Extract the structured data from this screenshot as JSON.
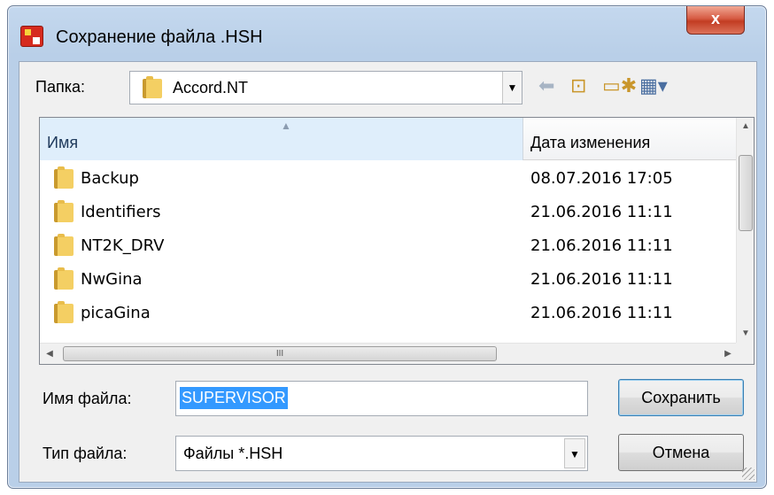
{
  "window": {
    "title": "Сохранение файла .HSH",
    "close_label": "x"
  },
  "location": {
    "label": "Папка:",
    "current_folder": "Accord.NT"
  },
  "toolbar": {
    "back_icon": "back-arrow-icon",
    "up_icon": "up-folder-icon",
    "new_folder_icon": "new-folder-icon",
    "view_menu_icon": "view-menu-icon"
  },
  "file_list": {
    "columns": [
      "Имя",
      "Дата изменения"
    ],
    "rows": [
      {
        "name": "Backup",
        "date": "08.07.2016 17:05"
      },
      {
        "name": "Identifiers",
        "date": "21.06.2016 11:11"
      },
      {
        "name": "NT2K_DRV",
        "date": "21.06.2016 11:11"
      },
      {
        "name": "NwGina",
        "date": "21.06.2016 11:11"
      },
      {
        "name": "picaGina",
        "date": "21.06.2016 11:11"
      }
    ]
  },
  "filename": {
    "label": "Имя файла:",
    "value": "SUPERVISOR"
  },
  "filetype": {
    "label": "Тип файла:",
    "value": "Файлы  *.HSH"
  },
  "buttons": {
    "save": "Сохранить",
    "cancel": "Отмена"
  }
}
